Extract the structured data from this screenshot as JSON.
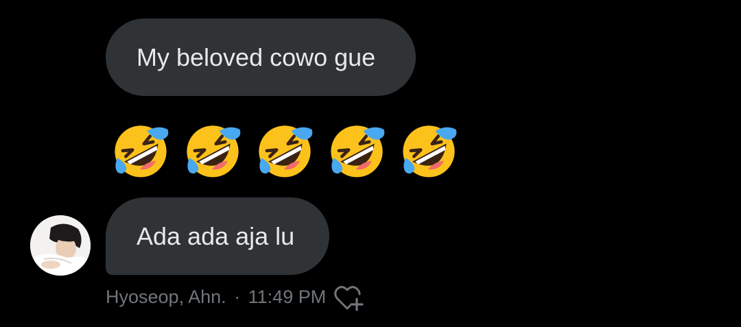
{
  "messages": [
    {
      "text": "My beloved cowo gue"
    },
    {
      "text": "Ada ada aja lu"
    }
  ],
  "emoji_reply": {
    "icon": "rolling-on-the-floor-laughing-icon",
    "count": 5
  },
  "sender": {
    "name": "Hyoseop, Ahn.",
    "separator": "·",
    "time": "11:49 PM"
  },
  "icons": {
    "avatar": "avatar",
    "react": "heart-plus-icon"
  },
  "colors": {
    "background": "#000000",
    "bubble": "#2f3336",
    "bubble_text": "#e7e9ea",
    "meta_text": "#71767b",
    "emoji_face": "#fcc21b",
    "emoji_tear": "#4aa8f0"
  }
}
